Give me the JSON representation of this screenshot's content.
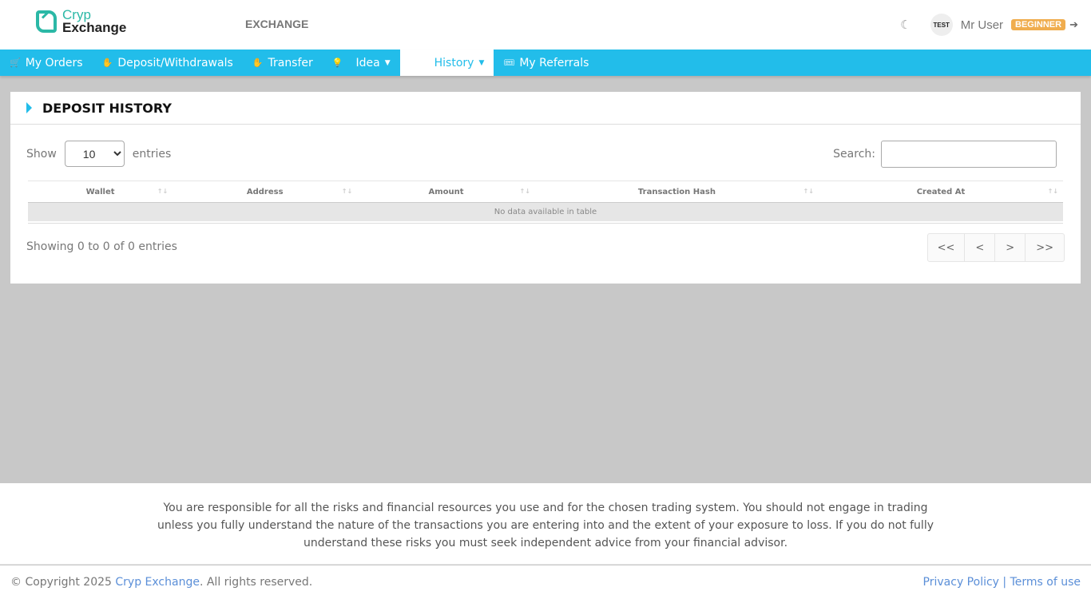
{
  "header": {
    "logo_line1": "Cryp",
    "logo_line2": "Exchange",
    "section": "EXCHANGE",
    "user_name": "Mr User",
    "level_badge": "BEGINNER",
    "avatar_text": "TEST"
  },
  "nav": {
    "items": [
      {
        "label": "My Orders",
        "icon": "cart-icon",
        "glyph": "🛒"
      },
      {
        "label": "Deposit/Withdrawals",
        "icon": "money-icon",
        "glyph": "✋"
      },
      {
        "label": "Transfer",
        "icon": "money-icon",
        "glyph": "✋"
      },
      {
        "label": "Idea",
        "icon": "lightbulb-icon",
        "glyph": "💡"
      },
      {
        "label": "History",
        "icon": "",
        "glyph": ""
      },
      {
        "label": "My Referrals",
        "icon": "ticket-icon",
        "glyph": "🎟"
      }
    ]
  },
  "card": {
    "title": "DEPOSIT HISTORY",
    "show_label": "Show",
    "entries_label": "entries",
    "page_size": "10",
    "search_label": "Search:",
    "search_value": "",
    "columns": [
      "Wallet",
      "Address",
      "Amount",
      "Transaction Hash",
      "Created At"
    ],
    "empty_text": "No data available in table",
    "info": "Showing 0 to 0 of 0 entries",
    "pager": [
      "<<",
      "<",
      ">",
      ">>"
    ]
  },
  "disclaimer": "You are responsible for all the risks and financial resources you use and for the chosen trading system. You should not engage in trading unless you fully understand the nature of the transactions you are entering into and the extent of your exposure to loss. If you do not fully understand these risks you must seek independent advice from your financial advisor.",
  "footer": {
    "copyright_prefix": "© Copyright 2025 ",
    "brand": "Cryp Exchange",
    "copyright_suffix": ". All rights reserved.",
    "privacy": "Privacy Policy",
    "sep": " | ",
    "terms": "Terms of use"
  },
  "colors": {
    "accent": "#22bdea",
    "badge": "#f0ad4e",
    "logo": "#2bb8a6"
  }
}
